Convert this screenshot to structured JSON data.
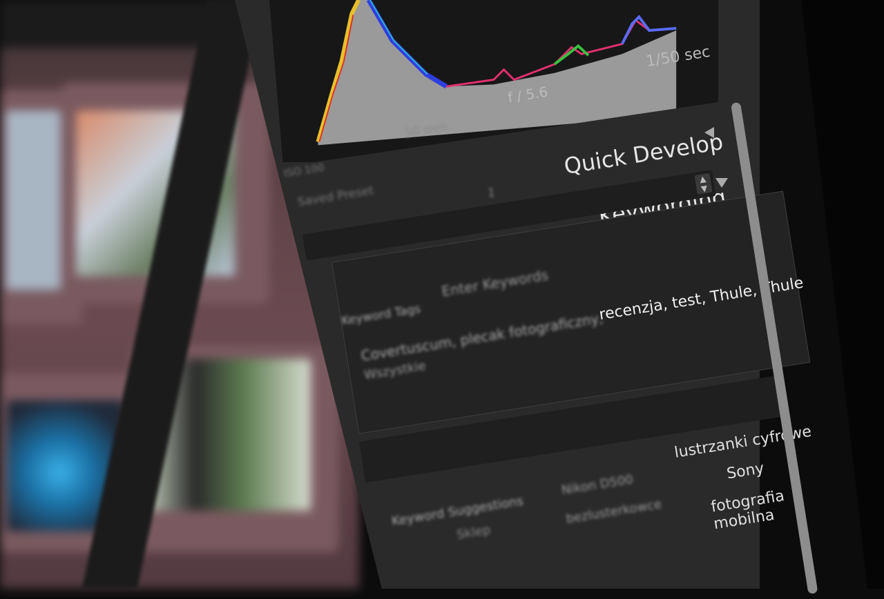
{
  "histogram": {
    "shutter": "1/50 sec",
    "aperture": "f / 5.6",
    "focal": "50 mm",
    "iso": "ISO 100"
  },
  "panels": {
    "quick_develop": "Quick Develop",
    "keywording": "Keywording"
  },
  "saved_preset": {
    "label": "Saved Preset",
    "count": "1"
  },
  "keyword_tags": {
    "label": "Keyword Tags",
    "placeholder": "Enter Keywords",
    "value": "recenzja, test, Thule, Thule",
    "value_blur": "Covertuscum, plecak fotograficzny,",
    "extra_line": "Wszystkie"
  },
  "keyword_suggestions": {
    "title": "Keyword Suggestions",
    "col1": [
      "",
      "Nikon D500",
      "Sklep"
    ],
    "col2": [
      "lustrzanki cyfrowe",
      "Sony",
      "fotografia mobilna"
    ],
    "col1b": [
      "",
      "",
      "bezlusterkowce"
    ]
  }
}
